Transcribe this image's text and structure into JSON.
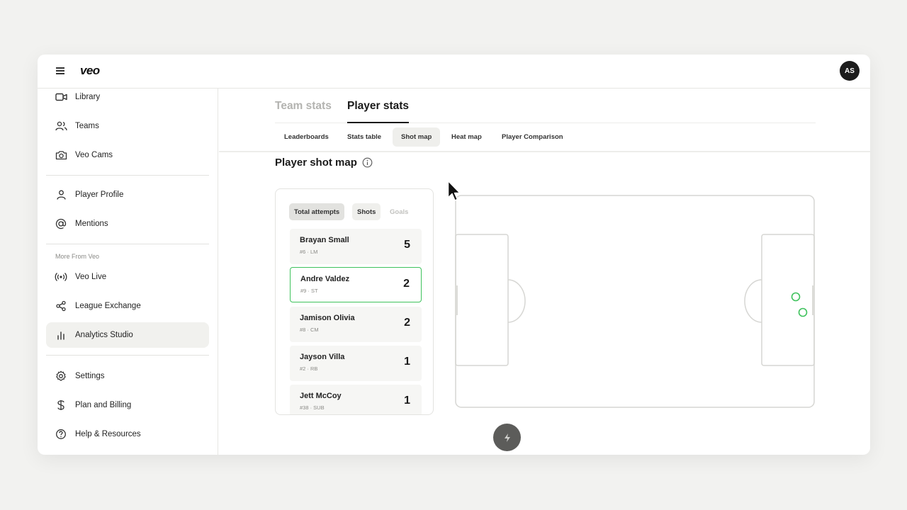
{
  "app": {
    "logo": "veo",
    "avatar_initials": "AS"
  },
  "sidebar": {
    "items": [
      {
        "label": "Library",
        "icon": "video-camera-icon"
      },
      {
        "label": "Teams",
        "icon": "users-icon"
      },
      {
        "label": "Veo Cams",
        "icon": "camera-icon"
      },
      {
        "label": "Player Profile",
        "icon": "user-icon"
      },
      {
        "label": "Mentions",
        "icon": "at-sign-icon"
      },
      {
        "label": "Veo Live",
        "icon": "broadcast-icon"
      },
      {
        "label": "League Exchange",
        "icon": "share-icon"
      },
      {
        "label": "Analytics Studio",
        "icon": "bar-chart-icon",
        "active": true
      },
      {
        "label": "Settings",
        "icon": "gear-icon"
      },
      {
        "label": "Plan and Billing",
        "icon": "dollar-icon"
      },
      {
        "label": "Help & Resources",
        "icon": "help-icon"
      }
    ],
    "section_label": "More From Veo"
  },
  "tabs": [
    "Team stats",
    "Player stats"
  ],
  "active_tab": "Player stats",
  "subtabs": [
    "Leaderboards",
    "Stats table",
    "Shot map",
    "Heat map",
    "Player Comparison"
  ],
  "active_subtab": "Shot map",
  "section_title": "Player shot map",
  "filters": [
    "Total attempts",
    "Shots",
    "Goals"
  ],
  "players": [
    {
      "name": "Brayan Small",
      "meta": "#6 · LM",
      "count": "5"
    },
    {
      "name": "Andre Valdez",
      "meta": "#9 · ST",
      "count": "2",
      "selected": true
    },
    {
      "name": "Jamison Olivia",
      "meta": "#8 · CM",
      "count": "2"
    },
    {
      "name": "Jayson Villa",
      "meta": "#2 · RB",
      "count": "1"
    },
    {
      "name": "Jett McCoy",
      "meta": "#38 · SUB",
      "count": "1"
    }
  ],
  "colors": {
    "accent_green": "#3ec25c",
    "dark": "#1a1a1a",
    "fab": "#5c5c5a"
  }
}
